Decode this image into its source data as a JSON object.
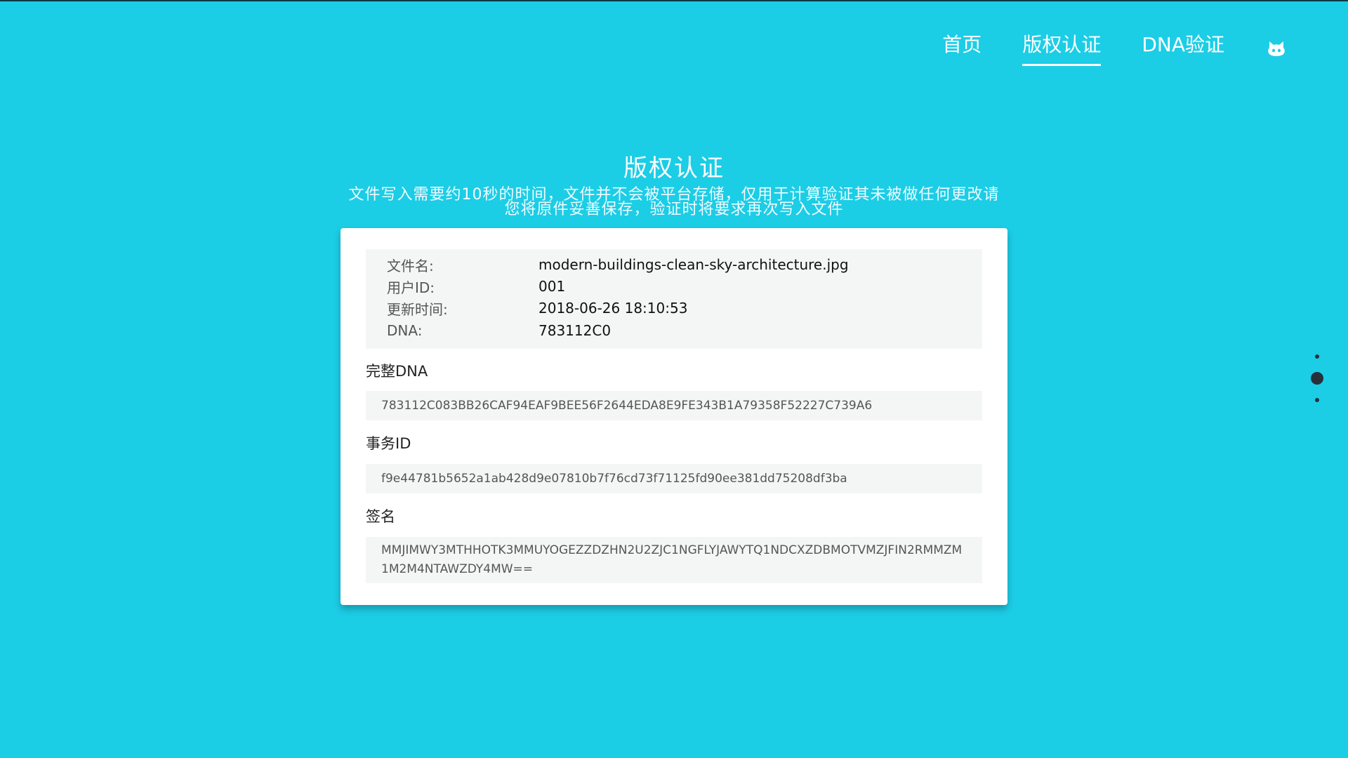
{
  "nav": {
    "items": [
      {
        "label": "首页",
        "active": false
      },
      {
        "label": "版权认证",
        "active": true
      },
      {
        "label": "DNA验证",
        "active": false
      }
    ],
    "github_icon": "github-icon"
  },
  "hero": {
    "title": "版权认证",
    "subtitle": "文件写入需要约10秒的时间，文件并不会被平台存储，仅用于计算验证其未被做任何更改请您将原件妥善保存，验证时将要求再次写入文件"
  },
  "info": {
    "file_name_label": "文件名:",
    "file_name": "modern-buildings-clean-sky-architecture.jpg",
    "user_id_label": "用户ID:",
    "user_id": "001",
    "updated_label": "更新时间:",
    "updated": "2018-06-26 18:10:53",
    "dna_label": "DNA:",
    "dna": "783112C0"
  },
  "full_dna": {
    "label": "完整DNA",
    "value": "783112C083BB26CAF94EAF9BEE56F2644EDA8E9FE343B1A79358F52227C739A6"
  },
  "transaction": {
    "label": "事务ID",
    "value": "f9e44781b5652a1ab428d9e07810b7f76cd73f71125fd90ee381dd75208df3ba"
  },
  "signature": {
    "label": "签名",
    "value": "MMJIMWY3MTHHOTK3MMUYOGEZZDZHN2U2ZJC1NGFLYJAWYTQ1NDCXZDBMOTVMZJFIN2RMMZM1M2M4NTAWZDY4MW=="
  },
  "page_dots": {
    "count": 3,
    "active_index": 1
  },
  "colors": {
    "background": "#1ccde6",
    "card": "#ffffff",
    "field": "#f4f6f6"
  }
}
